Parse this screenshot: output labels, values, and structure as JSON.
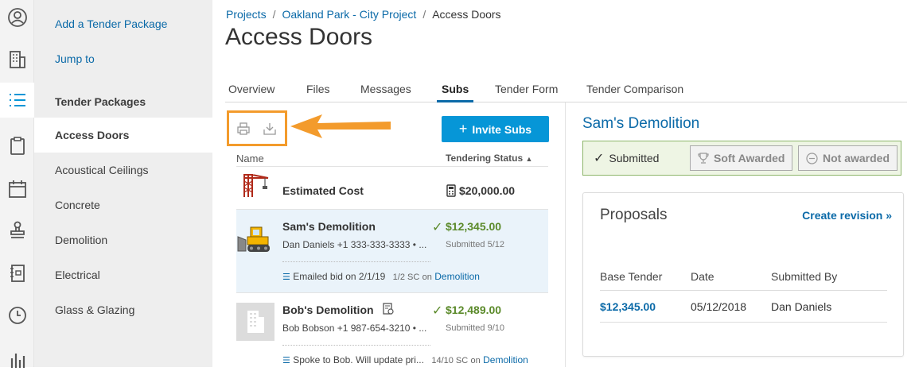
{
  "rail": {
    "icons": [
      "user-icon",
      "building-icon",
      "list-icon",
      "clipboard-icon",
      "calendar-icon",
      "stamp-icon",
      "notebook-icon",
      "clock-icon",
      "chart-icon"
    ],
    "active_index": 2,
    "accent": "#0696d7"
  },
  "sidebar": {
    "add_link": "Add a Tender Package",
    "jump_link": "Jump to",
    "section_header": "Tender Packages",
    "items": [
      "Access Doors",
      "Acoustical Ceilings",
      "Concrete",
      "Demolition",
      "Electrical",
      "Glass & Glazing"
    ],
    "active_item": "Access Doors"
  },
  "breadcrumb": {
    "items": [
      "Projects",
      "Oakland Park - City Project",
      "Access Doors"
    ],
    "separator": "/"
  },
  "page_title": "Access Doors",
  "tabs": [
    "Overview",
    "Files",
    "Messages",
    "Subs",
    "Tender Form",
    "Tender Comparison"
  ],
  "active_tab": "Subs",
  "toolbar": {
    "print_icon": "print-icon",
    "download_icon": "download-icon",
    "highlight_color": "#f39b2c"
  },
  "invite_button": {
    "label": "Invite Subs",
    "icon": "plus-icon",
    "color": "#0696d7"
  },
  "subs_table": {
    "columns": {
      "name": "Name",
      "status": "Tendering Status"
    },
    "sort_indicator": "▲",
    "rows": [
      {
        "type": "estimate",
        "name": "Estimated Cost",
        "amount": "$20,000.00",
        "icon": "crane-icon",
        "amount_icon": "calculator-icon"
      },
      {
        "type": "sub",
        "name": "Sam's Demolition",
        "contact": "Dan Daniels +1 333-333-3333 • ...",
        "amount": "$12,345.00",
        "status": "Submitted 5/12",
        "note": "Emailed bid on 2/1/19",
        "sc": "1/2 SC",
        "trade": "Demolition",
        "on": "on",
        "icon": "bulldozer-icon",
        "selected": true
      },
      {
        "type": "sub",
        "name": "Bob's Demolition",
        "contact": "Bob Bobson +1 987-654-3210 • ...",
        "amount": "$12,489.00",
        "status": "Submitted 9/10",
        "note": "Spoke to Bob. Will update pri...",
        "sc": "14/10 SC",
        "trade": "Demolition",
        "on": "on",
        "icon": "building-placeholder-icon",
        "selected": false
      }
    ]
  },
  "detail": {
    "title": "Sam's Demolition",
    "status_buttons": [
      "Submitted",
      "Soft Awarded",
      "Not awarded"
    ],
    "active_status": "Submitted",
    "proposals": {
      "title": "Proposals",
      "create_revision": "Create revision »",
      "headers": [
        "Base Tender",
        "Date",
        "Submitted By"
      ],
      "rows": [
        {
          "base_tender": "$12,345.00",
          "date": "05/12/2018",
          "submitted_by": "Dan Daniels"
        }
      ]
    }
  }
}
